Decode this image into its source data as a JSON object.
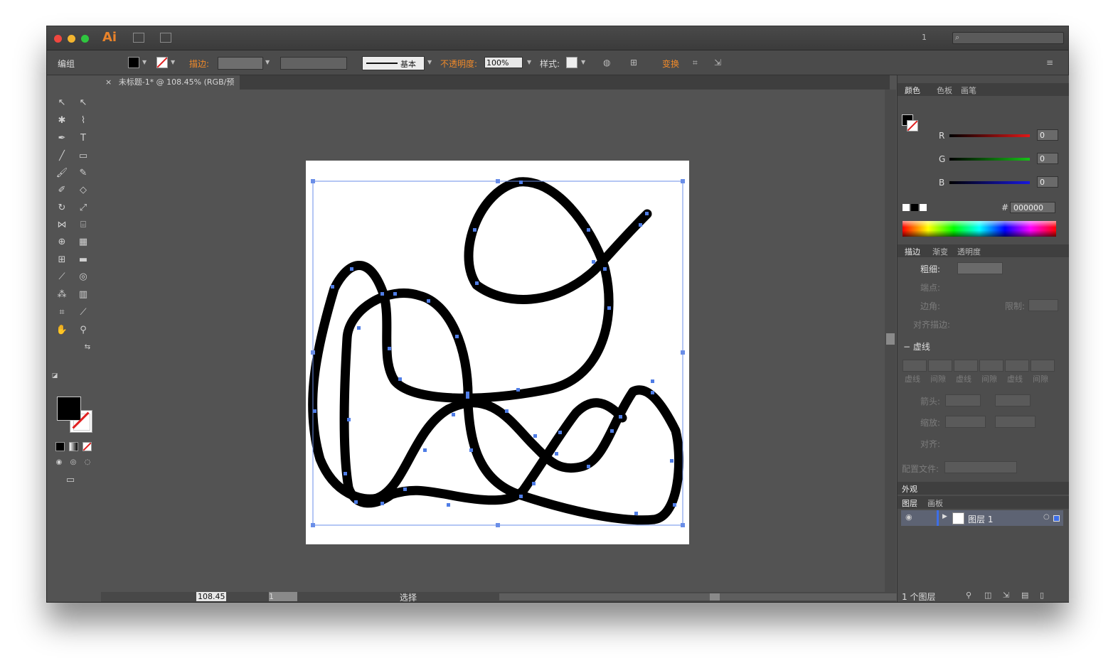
{
  "app": {
    "logo": "Ai",
    "page_indicator": "1",
    "search_placeholder": ""
  },
  "control_bar": {
    "selection_label": "编组",
    "stroke_label": "描边:",
    "stroke_style": "基本",
    "opacity_label": "不透明度:",
    "opacity_value": "100%",
    "style_label": "样式:",
    "transform_label": "变换"
  },
  "document": {
    "tab_title": "未标题-1* @ 108.45% (RGB/预览)",
    "close_glyph": "×"
  },
  "status": {
    "zoom": "108.45",
    "page": "1",
    "tool": "选择"
  },
  "panels": {
    "color": {
      "tabs": [
        "颜色",
        "色板",
        "画笔"
      ],
      "channels": [
        {
          "label": "R",
          "value": "0",
          "color": "#e01818"
        },
        {
          "label": "G",
          "value": "0",
          "color": "#18c018"
        },
        {
          "label": "B",
          "value": "0",
          "color": "#1818e0"
        }
      ],
      "hex_label": "#",
      "hex_value": "000000"
    },
    "stroke": {
      "tabs": [
        "描边",
        "渐变",
        "透明度"
      ],
      "weight_label": "粗细:",
      "cap_label": "端点:",
      "corner_label": "边角:",
      "limit_label": "限制:",
      "align_label": "对齐描边:",
      "dashed_label": "虚线",
      "dash_labels": [
        "虚线",
        "间隙",
        "虚线",
        "间隙",
        "虚线",
        "间隙"
      ],
      "arrow_label": "箭头:",
      "scale_label": "缩放:",
      "align2_label": "对齐:",
      "profile_label": "配置文件:"
    },
    "appearance": {
      "title": "外观"
    },
    "layers": {
      "tabs": [
        "图层",
        "画板"
      ],
      "layer_name": "图层 1",
      "count_text": "1 个图层"
    }
  }
}
